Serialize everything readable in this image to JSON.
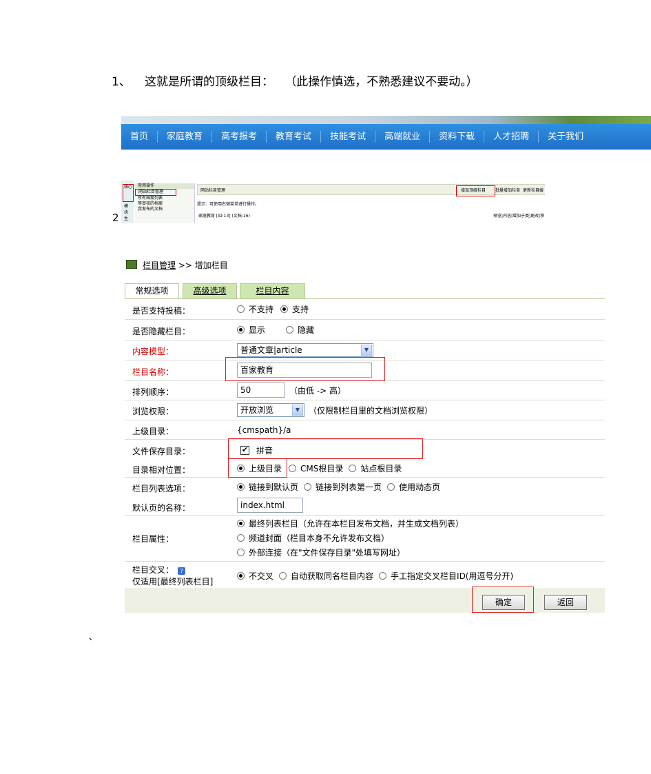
{
  "step1": {
    "number": "1、",
    "text": "这就是所谓的顶级栏目：",
    "note": "（此操作慎选，不熟悉建议不要动。）"
  },
  "nav": {
    "items": [
      "首页",
      "家庭教育",
      "高考报考",
      "教育考试",
      "技能考试",
      "高端就业",
      "资料下载",
      "人才招聘",
      "关于我们"
    ]
  },
  "step2": {
    "number": "2"
  },
  "thumbnail": {
    "left_box": "核心",
    "left_items": [
      "模",
      "块",
      "生"
    ],
    "menu_title": "常用操作",
    "menu_items": [
      "网站栏目管理",
      "所有档案列表",
      "等审核的档案",
      "我发布的文档"
    ],
    "header_title": "网站栏目管理",
    "header_buttons": [
      "增加顶级栏目",
      "批量增加栏目",
      "更新栏目缓"
    ],
    "tip": "提示：可使用右键菜单进行操作。",
    "row_text": "家庭教育 [ID:13] (文档:16)",
    "row_actions": "预览|内容|增加子类|更改|移"
  },
  "breadcrumb": {
    "link": "栏目管理",
    "sep": ">>",
    "current": "增加栏目"
  },
  "tabs": [
    "常规选项",
    "高级选项",
    "栏目内容"
  ],
  "form": {
    "allow_submit": {
      "label": "是否支持投稿：",
      "options": [
        "不支持",
        "支持"
      ],
      "selected": 1
    },
    "hidden": {
      "label": "是否隐藏栏目：",
      "options": [
        "显示",
        "隐藏"
      ],
      "selected": 0
    },
    "model": {
      "label": "内容模型：",
      "value": "普通文章|article"
    },
    "name": {
      "label": "栏目名称：",
      "value": "百家教育"
    },
    "order": {
      "label": "排列顺序：",
      "value": "50",
      "hint": "（由低 -> 高）"
    },
    "permission": {
      "label": "浏览权限：",
      "value": "开放浏览",
      "hint": "（仅限制栏目里的文档浏览权限）"
    },
    "parent_dir": {
      "label": "上级目录：",
      "value": "{cmspath}/a"
    },
    "save_dir": {
      "label": "文件保存目录：",
      "checkbox_label": "拼音",
      "checked": true
    },
    "relative_pos": {
      "label": "目录相对位置：",
      "options": [
        "上级目录",
        "CMS根目录",
        "站点根目录"
      ],
      "selected": 0
    },
    "list_option": {
      "label": "栏目列表选项：",
      "options": [
        "链接到默认页",
        "链接到列表第一页",
        "使用动态页"
      ],
      "selected": 0
    },
    "default_page": {
      "label": "默认页的名称：",
      "value": "index.html"
    },
    "attribute": {
      "label": "栏目属性：",
      "options": [
        "最终列表栏目（允许在本栏目发布文档，并生成文档列表）",
        "频道封面（栏目本身不允许发布文档）",
        "外部连接（在\"文件保存目录\"处填写网址）"
      ],
      "selected": 0
    },
    "cross": {
      "label": "栏目交叉：",
      "sublabel": "仅适用[最终列表栏目]",
      "options": [
        "不交叉",
        "自动获取同名栏目内容",
        "手工指定交叉栏目ID(用逗号分开)"
      ],
      "selected": 0
    },
    "confirm": "确定",
    "back": "返回"
  },
  "footer_mark": "、"
}
